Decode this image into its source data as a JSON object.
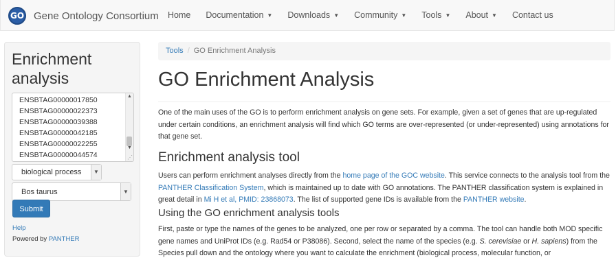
{
  "navbar": {
    "logo_text": "GO",
    "brand": "Gene Ontology Consortium",
    "items": [
      {
        "label": "Home",
        "dropdown": false
      },
      {
        "label": "Documentation",
        "dropdown": true
      },
      {
        "label": "Downloads",
        "dropdown": true
      },
      {
        "label": "Community",
        "dropdown": true
      },
      {
        "label": "Tools",
        "dropdown": true
      },
      {
        "label": "About",
        "dropdown": true
      },
      {
        "label": "Contact us",
        "dropdown": false
      }
    ]
  },
  "sidebar": {
    "title": "Enrichment analysis",
    "genes": [
      "ENSBTAG00000017850",
      "ENSBTAG00000022373",
      "ENSBTAG00000039388",
      "ENSBTAG00000042185",
      "ENSBTAG00000022255",
      "ENSBTAG00000044574"
    ],
    "ontology_select": "biological process",
    "species_select": "Bos taurus",
    "submit_label": "Submit",
    "help_link": "Help",
    "powered_prefix": "Powered by ",
    "powered_link": "PANTHER"
  },
  "breadcrumb": {
    "tools": "Tools",
    "separator": "/",
    "current": "GO Enrichment Analysis"
  },
  "main": {
    "title": "GO Enrichment Analysis",
    "intro": "One of the main uses of the GO is to perform enrichment analysis on gene sets. For example, given a set of genes that are up-regulated under certain conditions, an enrichment analysis will find which GO terms are over-represented (or under-represented) using annotations for that gene set.",
    "tool_heading": "Enrichment analysis tool",
    "tool_para": {
      "t1": "Users can perform enrichment analyses directly from the ",
      "l1": "home page of the GOC website",
      "t2": ". This service connects to the analysis tool from the ",
      "l2": "PANTHER Classification System",
      "t3": ", which is maintained up to date with GO annotations. The PANTHER classification system is explained in great detail in ",
      "l3": "Mi H et al, PMID: 23868073",
      "t4": ". The list of supported gene IDs is available from the ",
      "l4": "PANTHER website",
      "t5": "."
    },
    "using_heading": "Using the GO enrichment analysis tools",
    "using_para": {
      "t1": "First, paste or type the names of the genes to be analyzed, one per row or separated by a comma. The tool can handle both MOD specific gene names and UniProt IDs (e.g. Rad54 or P38086). Second, select the name of the species (e.g. ",
      "i1": "S. cerevisiae",
      "t2": " or ",
      "i2": "H. sapiens",
      "t3": ") from the Species pull down and the ontology where you want to calculate the enrichment (biological process, molecular function, or"
    }
  }
}
